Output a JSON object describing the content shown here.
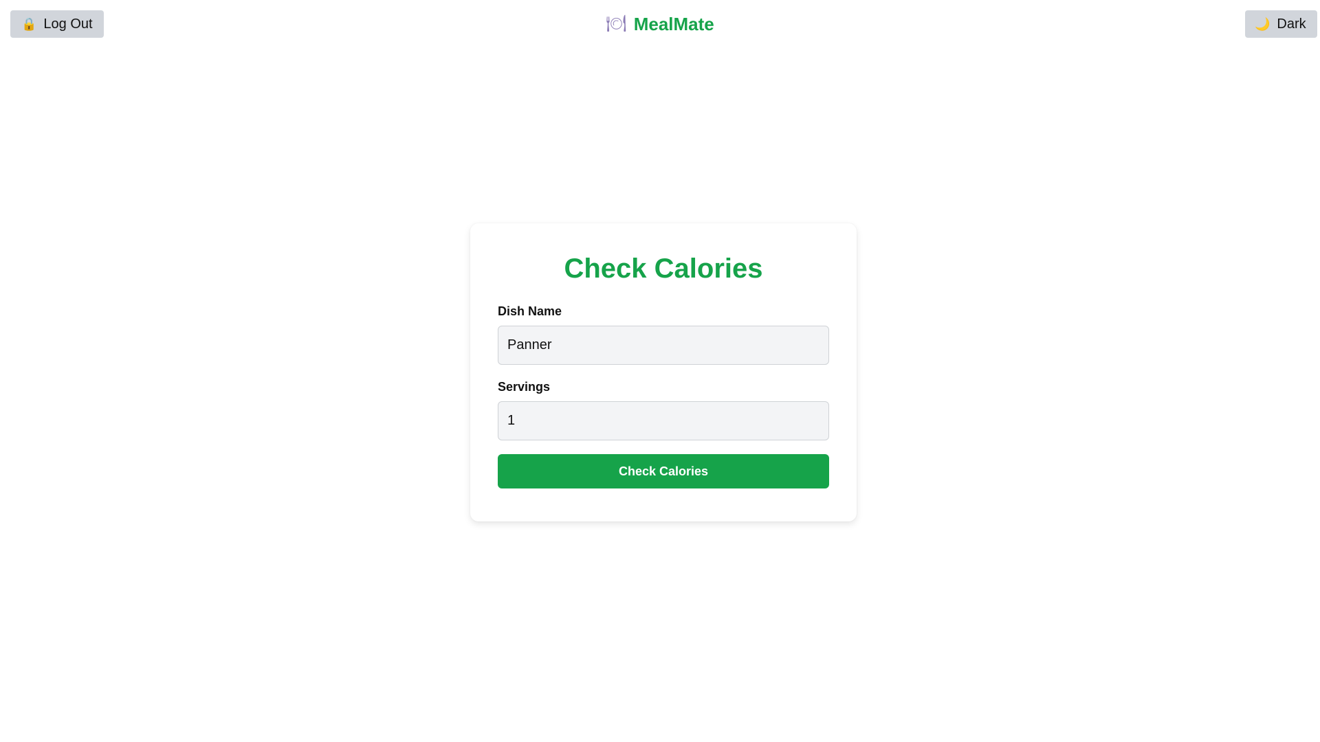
{
  "header": {
    "logout_label": "Log Out",
    "logout_icon": "lock-icon",
    "brand_name": "MealMate",
    "brand_icon": "plate-icon",
    "theme_label": "Dark",
    "theme_icon": "moon-icon"
  },
  "form": {
    "title": "Check Calories",
    "dish_label": "Dish Name",
    "dish_value": "Panner",
    "servings_label": "Servings",
    "servings_value": "1",
    "submit_label": "Check Calories"
  },
  "colors": {
    "accent": "#16a34a",
    "button_gray": "#d1d5db",
    "input_bg": "#f3f4f6"
  }
}
